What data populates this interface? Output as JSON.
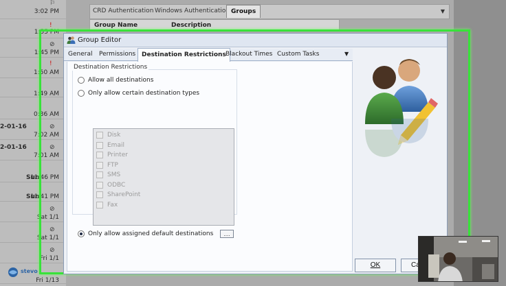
{
  "background": {
    "times": [
      "3:02 PM",
      "1:55 PM",
      "1:45 PM",
      "1:50 AM",
      "1:49 AM",
      "0:36 AM",
      "7:02 AM",
      "7:01 AM",
      "11:46 PM",
      "11:41 PM",
      "Sat 1/1",
      "Sat 1/1",
      "Fri 1/1",
      "Fri 1/13"
    ],
    "dates": [
      "2-01-16",
      "2-01-16"
    ],
    "days": [
      "Sun",
      "Sun"
    ],
    "tabs": [
      "CRD Authentication",
      "Windows Authentication",
      "Groups"
    ],
    "headers": [
      "Group Name",
      "Description"
    ]
  },
  "dialog": {
    "title": "Group Editor",
    "tabs": [
      "General",
      "Permissions",
      "Destination Restrictions",
      "Blackout Times",
      "Custom Tasks"
    ],
    "active_tab": "Destination Restrictions",
    "group_title": "Destination Restrictions",
    "options": {
      "allow_all": "Allow all destinations",
      "only_types": "Only allow certain destination types",
      "only_assigned": "Only allow assigned default destinations",
      "selected": "only_assigned"
    },
    "destination_types": [
      "Disk",
      "Email",
      "Printer",
      "FTP",
      "SMS",
      "ODBC",
      "SharePoint",
      "Fax"
    ],
    "browse_label": "....",
    "ok_label": "OK",
    "cancel_label": "Ca"
  },
  "watermark": {
    "text": "stevo"
  },
  "colors": {
    "highlight": "#38e23a",
    "accent": "#2c64a5"
  }
}
